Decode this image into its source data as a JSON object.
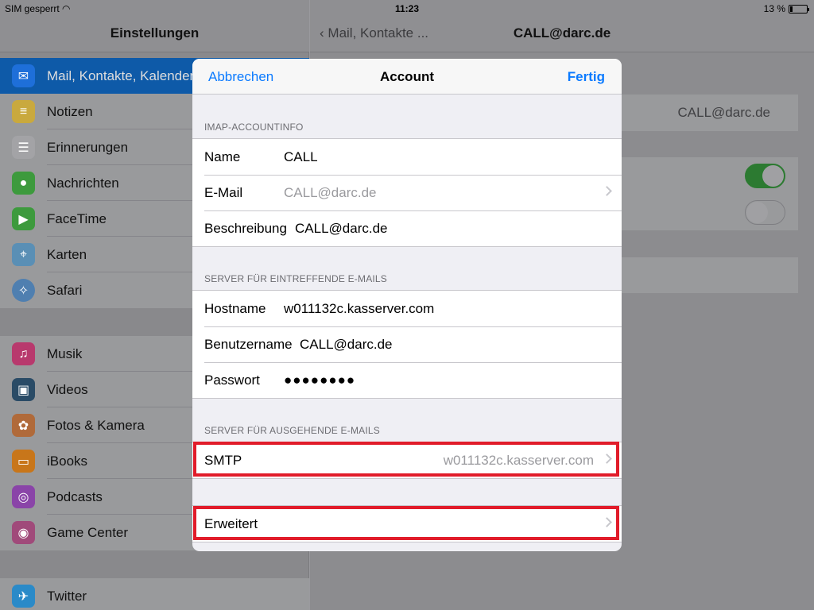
{
  "status_bar": {
    "carrier": "SIM gesperrt",
    "time": "11:23",
    "battery": "13 %",
    "battery_level": 0.13
  },
  "master": {
    "title": "Einstellungen",
    "items": [
      {
        "label": "Mail, Kontakte, Kalender",
        "icon": "mail-icon",
        "color": "#1e6fd9",
        "active": true
      },
      {
        "label": "Notizen",
        "icon": "notes-icon",
        "color": "#c9a93e"
      },
      {
        "label": "Erinnerungen",
        "icon": "reminders-icon",
        "color": "#a3a3a6"
      },
      {
        "label": "Nachrichten",
        "icon": "messages-icon",
        "color": "#3d9a3d"
      },
      {
        "label": "FaceTime",
        "icon": "facetime-icon",
        "color": "#3d9a3d"
      },
      {
        "label": "Karten",
        "icon": "maps-icon",
        "color": "#5a8fb5"
      },
      {
        "label": "Safari",
        "icon": "safari-icon",
        "color": "#4f7fb0"
      },
      {
        "label": "Musik",
        "icon": "music-icon",
        "color": "#b8396d"
      },
      {
        "label": "Videos",
        "icon": "videos-icon",
        "color": "#2a4b66"
      },
      {
        "label": "Fotos & Kamera",
        "icon": "photos-icon",
        "color": "#b06a3a"
      },
      {
        "label": "iBooks",
        "icon": "ibooks-icon",
        "color": "#c8761a"
      },
      {
        "label": "Podcasts",
        "icon": "podcasts-icon",
        "color": "#8a44a8"
      },
      {
        "label": "Game Center",
        "icon": "game-center-icon",
        "color": "#a04a7a"
      },
      {
        "label": "Twitter",
        "icon": "twitter-icon",
        "color": "#2a8ac8"
      }
    ]
  },
  "detail": {
    "back_label": "Mail, Kontakte ...",
    "title": "CALL@darc.de",
    "account_value": "CALL@darc.de"
  },
  "sheet": {
    "cancel_label": "Abbrechen",
    "title": "Account",
    "done_label": "Fertig",
    "imap_header": "IMAP-ACCOUNTINFO",
    "imap_rows": {
      "name_label": "Name",
      "name_value": "CALL",
      "email_label": "E-Mail",
      "email_value": "CALL@darc.de",
      "desc_label": "Beschreibung",
      "desc_value": "CALL@darc.de"
    },
    "incoming_header": "SERVER FÜR EINTREFFENDE E-MAILS",
    "incoming_rows": {
      "host_label": "Hostname",
      "host_value": "w011132c.kasserver.com",
      "user_label": "Benutzername",
      "user_value": "CALL@darc.de",
      "pass_label": "Passwort",
      "pass_value": "●●●●●●●●"
    },
    "outgoing_header": "SERVER FÜR AUSGEHENDE E-MAILS",
    "smtp_label": "SMTP",
    "smtp_value": "w011132c.kasserver.com",
    "advanced_label": "Erweitert"
  },
  "colors": {
    "accent": "#0a7aff",
    "highlight": "#e11c2a",
    "toggle_on": "#4cd964"
  }
}
